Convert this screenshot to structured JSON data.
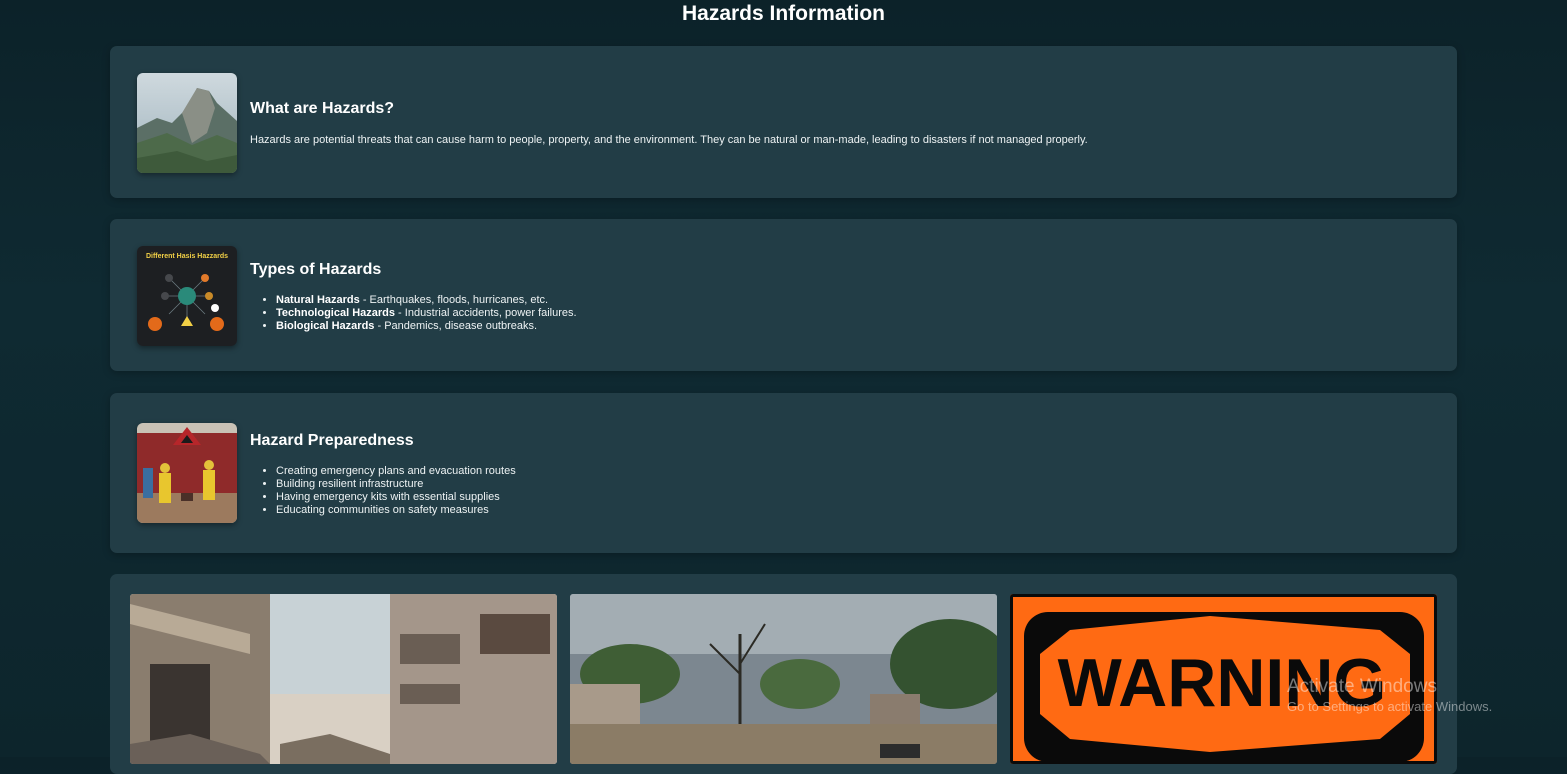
{
  "page": {
    "title": "Hazards Information"
  },
  "cards": [
    {
      "title": "What are Hazards?",
      "text": "Hazards are potential threats that can cause harm to people, property, and the environment. They can be natural or man-made, leading to disasters if not managed properly."
    },
    {
      "title": "Types of Hazards",
      "image_text": "Different Hasis Hazzards",
      "items": [
        {
          "label": "Natural Hazards",
          "text": " - Earthquakes, floods, hurricanes, etc."
        },
        {
          "label": "Technological Hazards",
          "text": " - Industrial accidents, power failures."
        },
        {
          "label": "Biological Hazards",
          "text": " - Pandemics, disease outbreaks."
        }
      ]
    },
    {
      "title": "Hazard Preparedness",
      "items": [
        "Creating emergency plans and evacuation routes",
        "Building resilient infrastructure",
        "Having emergency kits with essential supplies",
        "Educating communities on safety measures"
      ]
    }
  ],
  "gallery": {
    "warning_text": "WARNING"
  },
  "watermark": {
    "title": "Activate Windows",
    "subtitle": "Go to Settings to activate Windows."
  }
}
